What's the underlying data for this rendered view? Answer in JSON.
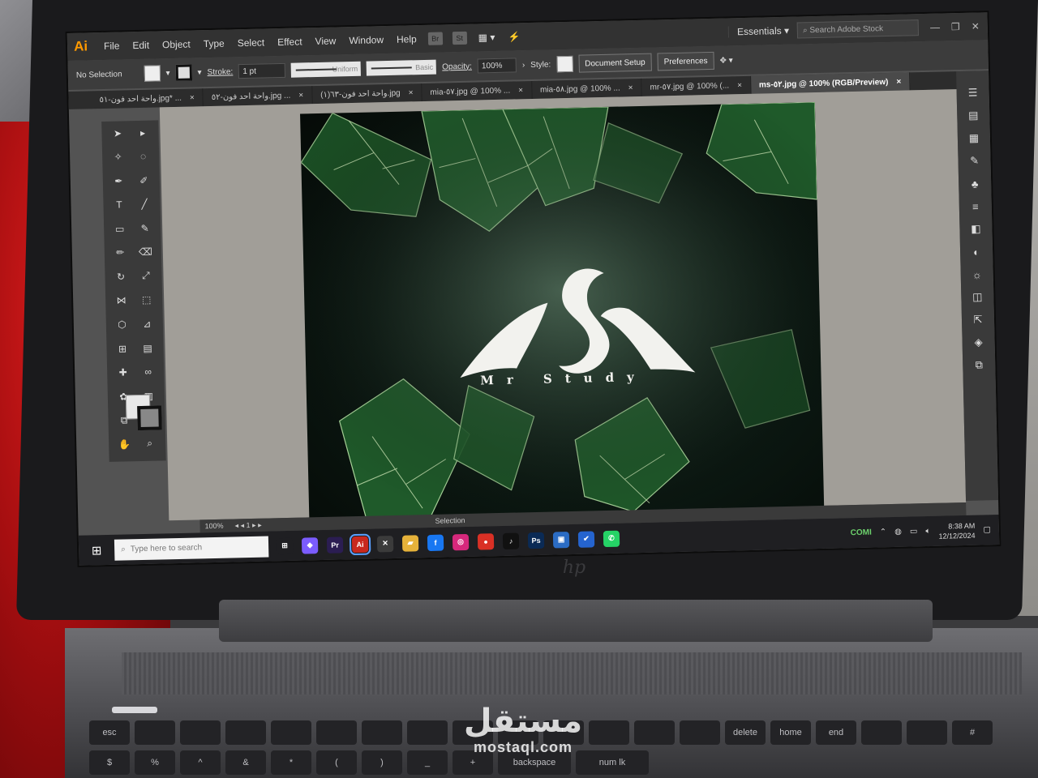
{
  "app": {
    "logo": "Ai",
    "menu": [
      "File",
      "Edit",
      "Object",
      "Type",
      "Select",
      "Effect",
      "View",
      "Window",
      "Help"
    ],
    "menu_buttons": [
      "Br",
      "St"
    ],
    "workspace": "Essentials",
    "search_placeholder": "Search Adobe Stock"
  },
  "control_bar": {
    "selection": "No Selection",
    "stroke_label": "Stroke:",
    "stroke_value": "1 pt",
    "profile": "Uniform",
    "brush": "Basic",
    "opacity_label": "Opacity:",
    "opacity_value": "100%",
    "style_label": "Style:",
    "document_setup": "Document Setup",
    "preferences": "Preferences"
  },
  "tabs": [
    {
      "label": "واحة احد فون-٥١.jpg* ...",
      "active": false
    },
    {
      "label": "واحة احد فون-٥٢.jpg ...",
      "active": false
    },
    {
      "label": "واحة احد فون-٦٣(١).jpg",
      "active": false
    },
    {
      "label": "mia-٥٧.jpg @ 100% ...",
      "active": false
    },
    {
      "label": "mia-٥٨.jpg @ 100% ...",
      "active": false
    },
    {
      "label": "mr-٥٧.jpg @ 100% (...",
      "active": false
    },
    {
      "label": "ms-٥٢.jpg @ 100% (RGB/Preview)",
      "active": true
    }
  ],
  "artwork": {
    "brand_text": "Mr Study",
    "colors": {
      "leaf": "#2f7a3c",
      "vein": "#cfe8b8",
      "logo": "#f2f2ee",
      "bg": "#0b1711"
    }
  },
  "status": {
    "zoom": "100%",
    "artboard": "1",
    "mode": "Selection"
  },
  "taskbar": {
    "search_placeholder": "Type here to search",
    "apps": [
      {
        "name": "task-view",
        "label": "⊞",
        "color": "#1f1f22"
      },
      {
        "name": "copilot",
        "label": "◆",
        "color": "#7b5cff"
      },
      {
        "name": "premiere",
        "label": "Pr",
        "color": "#2b1d52"
      },
      {
        "name": "illustrator",
        "label": "Ai",
        "color": "#c8281e",
        "active": true
      },
      {
        "name": "xbox",
        "label": "✕",
        "color": "#3b3b3b"
      },
      {
        "name": "explorer",
        "label": "▰",
        "color": "#e6b23a"
      },
      {
        "name": "facebook",
        "label": "f",
        "color": "#1877f2"
      },
      {
        "name": "instagram",
        "label": "◎",
        "color": "#d6287c"
      },
      {
        "name": "chrome",
        "label": "●",
        "color": "#d93025"
      },
      {
        "name": "tiktok",
        "label": "♪",
        "color": "#111111"
      },
      {
        "name": "photoshop",
        "label": "Ps",
        "color": "#0a2a55"
      },
      {
        "name": "photos",
        "label": "▣",
        "color": "#2b6cc4"
      },
      {
        "name": "todo",
        "label": "✔",
        "color": "#2564cf"
      },
      {
        "name": "whatsapp",
        "label": "✆",
        "color": "#25d366"
      }
    ],
    "stock_ticker": "COMI",
    "time": "8:38 AM",
    "date": "12/12/2024"
  },
  "keyboard": {
    "keys": [
      "esc",
      "",
      "",
      "",
      "",
      "",
      "",
      "",
      "",
      "",
      "",
      "",
      "",
      "",
      "delete",
      "home",
      "end",
      "",
      "",
      "#",
      "$",
      "%",
      "^",
      "&",
      "*",
      "(",
      ")",
      "_",
      "+",
      "backspace",
      "num lk"
    ]
  },
  "watermark": {
    "arabic": "مستقل",
    "latin": "mostaql.com"
  }
}
